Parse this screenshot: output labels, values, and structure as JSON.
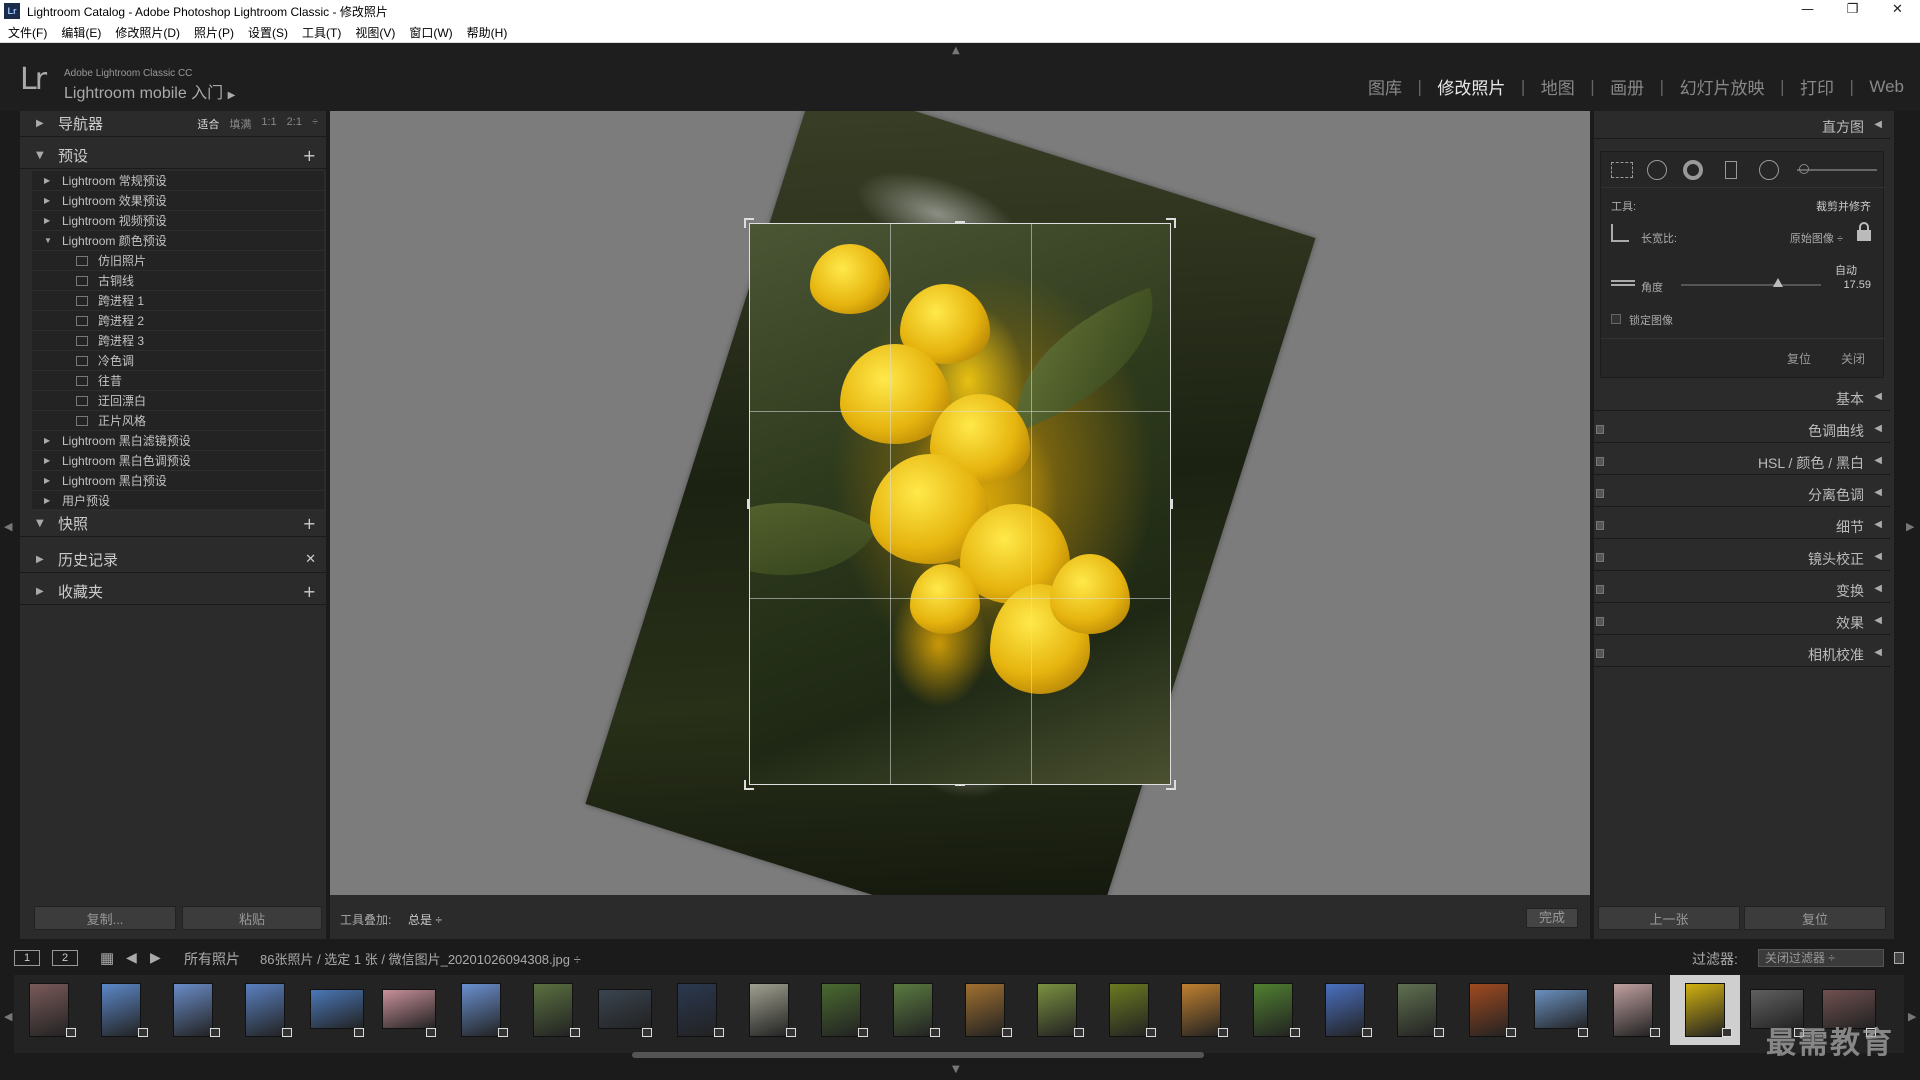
{
  "window": {
    "title": "Lightroom Catalog - Adobe Photoshop Lightroom Classic - 修改照片",
    "app_icon": "Lr",
    "controls": [
      "—",
      "❐",
      "✕"
    ]
  },
  "menu": [
    "文件(F)",
    "编辑(E)",
    "修改照片(D)",
    "照片(P)",
    "设置(S)",
    "工具(T)",
    "视图(V)",
    "窗口(W)",
    "帮助(H)"
  ],
  "identity": {
    "logo": "Lr",
    "line1": "Adobe Lightroom Classic CC",
    "line2": "Lightroom mobile 入门",
    "arrow": "▶"
  },
  "modules": [
    {
      "label": "图库",
      "active": false
    },
    {
      "label": "修改照片",
      "active": true
    },
    {
      "label": "地图",
      "active": false
    },
    {
      "label": "画册",
      "active": false
    },
    {
      "label": "幻灯片放映",
      "active": false
    },
    {
      "label": "打印",
      "active": false
    },
    {
      "label": "Web",
      "active": false
    }
  ],
  "left": {
    "navigator": {
      "title": "导航器",
      "zoom": [
        "适合",
        "填满",
        "1:1",
        "2:1"
      ],
      "zoom_selected": "适合"
    },
    "presets": {
      "title": "预设",
      "items": [
        {
          "label": "Lightroom 常规预设",
          "type": "folder",
          "expanded": false
        },
        {
          "label": "Lightroom 效果预设",
          "type": "folder",
          "expanded": false
        },
        {
          "label": "Lightroom 视频预设",
          "type": "folder",
          "expanded": false
        },
        {
          "label": "Lightroom 颜色预设",
          "type": "folder",
          "expanded": true
        },
        {
          "label": "仿旧照片",
          "type": "preset"
        },
        {
          "label": "古铜线",
          "type": "preset"
        },
        {
          "label": "跨进程 1",
          "type": "preset"
        },
        {
          "label": "跨进程 2",
          "type": "preset"
        },
        {
          "label": "跨进程 3",
          "type": "preset"
        },
        {
          "label": "冷色调",
          "type": "preset"
        },
        {
          "label": "往昔",
          "type": "preset"
        },
        {
          "label": "迂回漂白",
          "type": "preset"
        },
        {
          "label": "正片风格",
          "type": "preset"
        },
        {
          "label": "Lightroom 黑白滤镜预设",
          "type": "folder",
          "expanded": false
        },
        {
          "label": "Lightroom 黑白色调预设",
          "type": "folder",
          "expanded": false
        },
        {
          "label": "Lightroom 黑白预设",
          "type": "folder",
          "expanded": false
        },
        {
          "label": "用户预设",
          "type": "folder",
          "expanded": false
        }
      ]
    },
    "snapshots": {
      "title": "快照"
    },
    "history": {
      "title": "历史记录"
    },
    "collections": {
      "title": "收藏夹"
    },
    "copy_button": "复制...",
    "paste_button": "粘贴"
  },
  "toolbar": {
    "overlay_label": "工具叠加:",
    "overlay_value": "总是 ÷",
    "done_button": "完成"
  },
  "right": {
    "histogram_title": "直方图",
    "tool_label": "工具:",
    "tool_value": "裁剪并修齐",
    "aspect_label": "长宽比:",
    "aspect_value": "原始图像 ÷",
    "auto_label": "自动",
    "angle_label": "角度",
    "angle_value": "17.59",
    "angle": 17.59,
    "lock_image_label": "锁定图像",
    "reset_label": "复位",
    "close_label": "关闭",
    "panels": [
      {
        "label": "基本",
        "switch": false
      },
      {
        "label": "色调曲线",
        "switch": true
      },
      {
        "label": "HSL / 颜色 / 黑白",
        "switch": true
      },
      {
        "label": "分离色调",
        "switch": true
      },
      {
        "label": "细节",
        "switch": true
      },
      {
        "label": "镜头校正",
        "switch": true
      },
      {
        "label": "变换",
        "switch": true
      },
      {
        "label": "效果",
        "switch": true
      },
      {
        "label": "相机校准",
        "switch": true
      }
    ],
    "prev_button": "上一张",
    "reset_button": "复位"
  },
  "filmbar": {
    "monitor1": "1",
    "monitor2": "2",
    "source": "所有照片",
    "info": "86张照片 / 选定 1 张 / 微信图片_20201026094308.jpg ÷",
    "filter_label": "过滤器:",
    "filter_value": "关闭过滤器 ÷"
  },
  "watermark": "最需教育",
  "thumbnails": [
    {
      "color": "#7a5a5a",
      "orient": "tall"
    },
    {
      "color": "#5c88c8",
      "orient": "tall"
    },
    {
      "color": "#6a8cc8",
      "orient": "tall"
    },
    {
      "color": "#5a80c0",
      "orient": "tall"
    },
    {
      "color": "#4a78b8",
      "orient": "wide"
    },
    {
      "color": "#c8909a",
      "orient": "wide"
    },
    {
      "color": "#6a90d0",
      "orient": "tall"
    },
    {
      "color": "#5a7040",
      "orient": "tall"
    },
    {
      "color": "#3a4450",
      "orient": "wide"
    },
    {
      "color": "#2a3850",
      "orient": "tall"
    },
    {
      "color": "#a0a090",
      "orient": "tall"
    },
    {
      "color": "#4a6a30",
      "orient": "tall"
    },
    {
      "color": "#5a7a40",
      "orient": "tall"
    },
    {
      "color": "#a07030",
      "orient": "tall"
    },
    {
      "color": "#7a9040",
      "orient": "tall"
    },
    {
      "color": "#6a7a20",
      "orient": "tall"
    },
    {
      "color": "#c08030",
      "orient": "tall"
    },
    {
      "color": "#508030",
      "orient": "tall"
    },
    {
      "color": "#4a70c0",
      "orient": "tall"
    },
    {
      "color": "#607050",
      "orient": "tall"
    },
    {
      "color": "#a04a20",
      "orient": "tall"
    },
    {
      "color": "#6a90c0",
      "orient": "wide"
    },
    {
      "color": "#c0a0a0",
      "orient": "tall"
    },
    {
      "color": "#d0b010",
      "orient": "tall",
      "selected": true
    },
    {
      "color": "#606060",
      "orient": "wide"
    },
    {
      "color": "#705050",
      "orient": "wide"
    }
  ]
}
